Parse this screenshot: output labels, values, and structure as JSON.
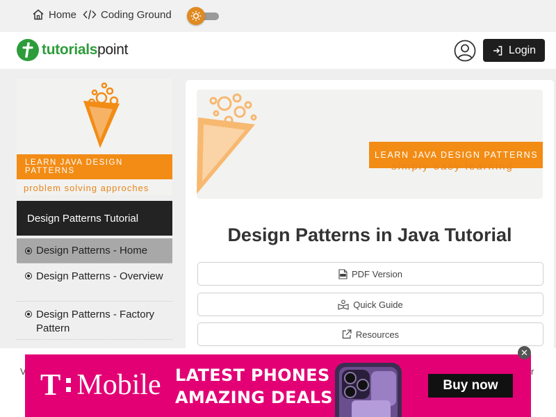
{
  "topbar": {
    "home_label": "Home",
    "coding_ground_label": "Coding Ground"
  },
  "header": {
    "logo_part1": "tutorials",
    "logo_part2": "point",
    "login_label": "Login"
  },
  "sidebar": {
    "banner_band": "LEARN JAVA DESIGN PATTERNS",
    "banner_tagline": "problem solving approches",
    "title": "Design Patterns Tutorial",
    "items": [
      {
        "label": "Design Patterns - Home",
        "active": true
      },
      {
        "label": "Design Patterns - Overview",
        "active": false
      },
      {
        "label": "Design Patterns - Factory Pattern",
        "active": false
      }
    ]
  },
  "main": {
    "banner_band": "LEARN JAVA DESIGN PATTERNS",
    "banner_tagline": "simply easy learning",
    "title": "Design Patterns in Java Tutorial",
    "buttons": [
      {
        "label": "PDF Version",
        "icon": "pdf-icon"
      },
      {
        "label": "Quick Guide",
        "icon": "quick-guide-icon"
      },
      {
        "label": "Resources",
        "icon": "external-link-icon"
      }
    ]
  },
  "ad": {
    "brand": "Mobile",
    "headline_line1": "LATEST PHONES",
    "headline_line2": "AMAZING DEALS",
    "cta": "Buy now",
    "peek_left": "V",
    "peek_right": "r",
    "close_glyph": "✕"
  },
  "colors": {
    "brand_green": "#2e9c3b",
    "accent_orange": "#f28c15",
    "ad_magenta": "#e20074",
    "dark": "#1e1e1e"
  }
}
